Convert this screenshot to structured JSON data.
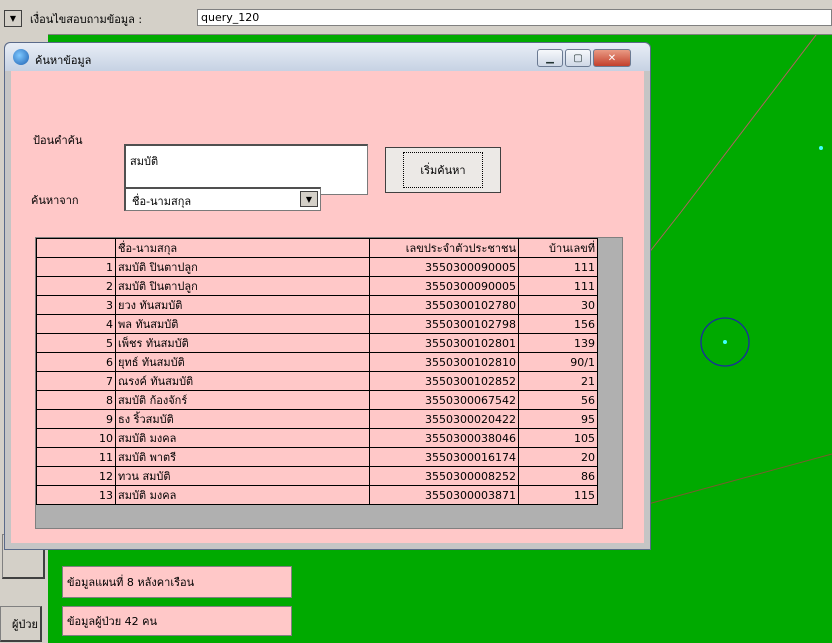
{
  "top": {
    "query_label": "เงื่อนไขสอบถามข้อมูล :",
    "query_value": "query_120"
  },
  "dialog": {
    "title": "ค้นหาข้อมูล",
    "search_label": "ป้อนคำค้น",
    "search_value": "สมบัติ",
    "search_button": "เริ่มค้นหา",
    "search_from_label": "ค้นหาจาก",
    "search_from_value": "ชื่อ-นามสกุล",
    "grid": {
      "headers": [
        "",
        "ชื่อ-นามสกุล",
        "เลขประจำตัวประชาชน",
        "บ้านเลขที่"
      ],
      "rows": [
        [
          "1",
          "สมบัติ ปินตาปลูก",
          "3550300090005",
          "111"
        ],
        [
          "2",
          "สมบัติ ปินตาปลูก",
          "3550300090005",
          "111"
        ],
        [
          "3",
          "ยวง ทันสมบัติ",
          "3550300102780",
          "30"
        ],
        [
          "4",
          "พล ทันสมบัติ",
          "3550300102798",
          "156"
        ],
        [
          "5",
          "เพ็ชร ทันสมบัติ",
          "3550300102801",
          "139"
        ],
        [
          "6",
          "ยุทธ์ ทันสมบัติ",
          "3550300102810",
          "90/1"
        ],
        [
          "7",
          "ณรงค์ ทันสมบัติ",
          "3550300102852",
          "21"
        ],
        [
          "8",
          "สมบัติ ก้องจักร์",
          "3550300067542",
          "56"
        ],
        [
          "9",
          "ธง ริ้วสมบัติ",
          "3550300020422",
          "95"
        ],
        [
          "10",
          "สมบัติ มงคล",
          "3550300038046",
          "105"
        ],
        [
          "11",
          "สมบัติ พาตรี",
          "3550300016174",
          "20"
        ],
        [
          "12",
          "ทวน สมบัติ",
          "3550300008252",
          "86"
        ],
        [
          "13",
          "สมบัติ มงคล",
          "3550300003871",
          "115"
        ]
      ]
    }
  },
  "panels": {
    "map_info": "ข้อมูลแผนที่ 8 หลังคาเรือน",
    "patient_info": "ข้อมูลผู้ป่วย 42 คน",
    "left_cut_label": "ผู้ป่วย"
  },
  "colors": {
    "map_green": "#00aa00",
    "dialog_client": "#ffc8c8",
    "marker_cyan": "#40ffff"
  }
}
